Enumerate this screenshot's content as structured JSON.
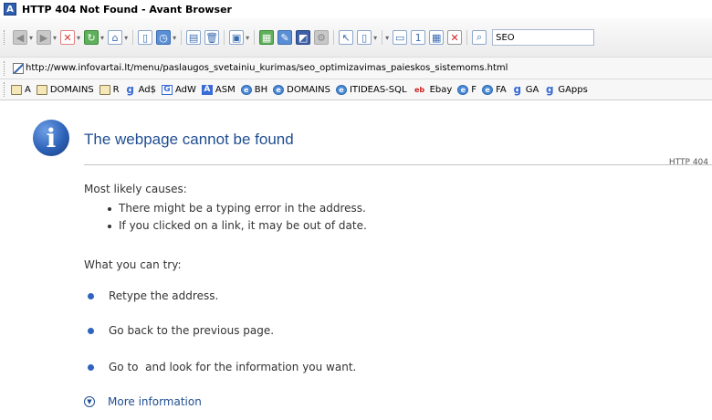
{
  "window": {
    "title": "HTTP 404 Not Found - Avant Browser",
    "app_icon": "A"
  },
  "toolbar": {
    "search_value": "SEO",
    "icons": [
      "back-icon",
      "forward-icon",
      "stop-icon",
      "refresh-icon",
      "home-icon",
      "page-icon",
      "history-icon",
      "print-icon",
      "delete-icon",
      "save-icon",
      "image-icon",
      "edit-icon",
      "window-icon",
      "gear-icon",
      "cursor-icon",
      "new-page-icon",
      "single-view-icon",
      "tile-view-icon",
      "close-all-icon",
      "search-icon"
    ]
  },
  "address": {
    "url": "http://www.infovartai.lt/menu/paslaugos_svetainiu_kurimas/seo_optimizavimas_paieskos_sistemoms.html"
  },
  "bookmarks": [
    {
      "label": "A",
      "icon": "folder-icon"
    },
    {
      "label": "DOMAINS",
      "icon": "folder-icon"
    },
    {
      "label": "R",
      "icon": "folder-icon"
    },
    {
      "label": "Ad$",
      "icon": "google-icon"
    },
    {
      "label": "AdW",
      "icon": "adwords-icon"
    },
    {
      "label": "ASM",
      "icon": "asm-icon"
    },
    {
      "label": "BH",
      "icon": "ie-icon"
    },
    {
      "label": "DOMAINS",
      "icon": "ie-icon"
    },
    {
      "label": "ITIDEAS-SQL",
      "icon": "ie-icon"
    },
    {
      "label": "Ebay",
      "icon": "ebay-icon"
    },
    {
      "label": "F",
      "icon": "ie-icon"
    },
    {
      "label": "FA",
      "icon": "ie-icon"
    },
    {
      "label": "GA",
      "icon": "google-icon"
    },
    {
      "label": "GApps",
      "icon": "google-icon"
    }
  ],
  "page": {
    "icon": "i",
    "title": "The webpage cannot be found",
    "code": "HTTP 404",
    "causes_heading": "Most likely causes:",
    "causes": [
      "There might be a typing error in the address.",
      "If you clicked on a link, it may be out of date."
    ],
    "try_heading": "What you can try:",
    "try_items": [
      "Retype the address.",
      "Go back to the previous page.",
      "Go to  and look for the information you want."
    ],
    "more_info": "More information"
  },
  "colors": {
    "title_blue": "#1f4e91",
    "bullet_blue": "#2e63c0"
  }
}
